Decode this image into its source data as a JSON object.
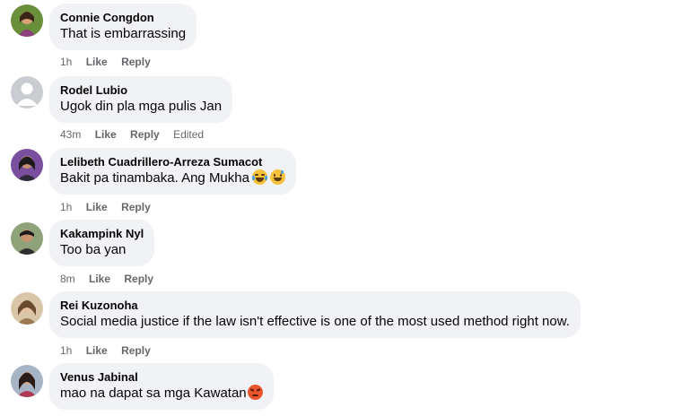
{
  "comments": [
    {
      "author": "Connie Congdon",
      "text": "That is embarrassing",
      "time": "1h",
      "like": "Like",
      "reply": "Reply"
    },
    {
      "author": "Rodel Lubio",
      "text": "Ugok din pla mga pulis Jan",
      "time": "43m",
      "like": "Like",
      "reply": "Reply",
      "edited": "Edited"
    },
    {
      "author": "Lelibeth Cuadrillero-Arreza Sumacot",
      "text": "Bakit pa tinambaka. Ang Mukha",
      "time": "1h",
      "like": "Like",
      "reply": "Reply",
      "emojis": [
        "face-with-tears-of-joy",
        "grinning-face-with-sweat"
      ]
    },
    {
      "author": "Kakampink Nyl",
      "text": "Too ba yan",
      "time": "8m",
      "like": "Like",
      "reply": "Reply"
    },
    {
      "author": "Rei Kuzonoha",
      "text": "Social media justice if the law isn't effective is one of the most used method right now.",
      "time": "1h",
      "like": "Like",
      "reply": "Reply"
    },
    {
      "author": "Venus Jabinal",
      "text": "mao na dapat sa mga Kawatan",
      "emojis": [
        "angry-face"
      ]
    }
  ],
  "colors": {
    "bubble": "#f0f2f5",
    "meta": "#65676b",
    "text": "#050505"
  }
}
